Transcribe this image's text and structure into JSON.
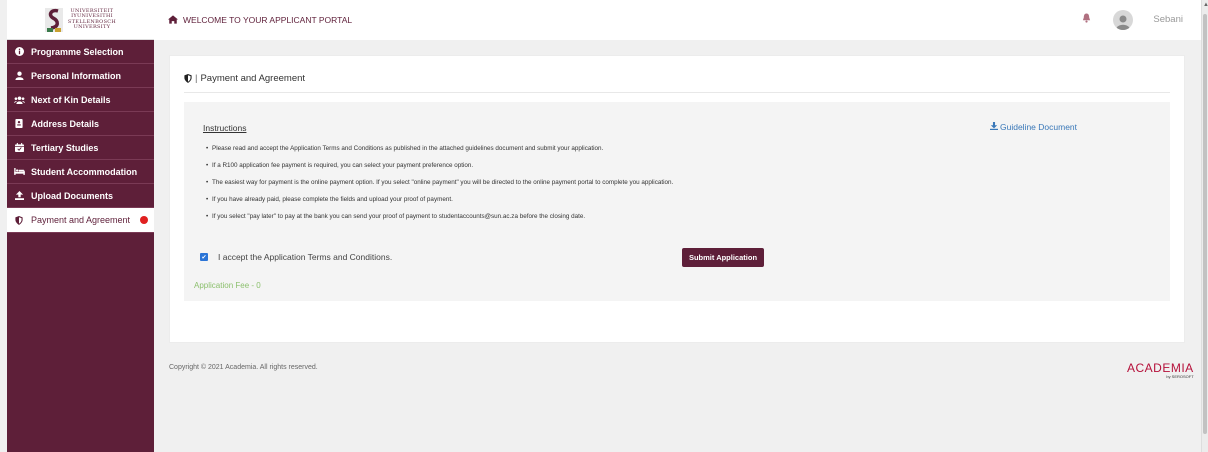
{
  "university": {
    "logo_lines": [
      "UNIVERSITEIT",
      "IYUNIVESITHI",
      "STELLENBOSCH",
      "UNIVERSITY"
    ]
  },
  "header": {
    "welcome": "WELCOME TO YOUR APPLICANT PORTAL",
    "username": "Sebani"
  },
  "sidebar": {
    "items": [
      {
        "label": "Programme Selection",
        "icon": "info-circle-icon"
      },
      {
        "label": "Personal Information",
        "icon": "user-icon"
      },
      {
        "label": "Next of Kin Details",
        "icon": "users-icon"
      },
      {
        "label": "Address Details",
        "icon": "address-card-icon"
      },
      {
        "label": "Tertiary Studies",
        "icon": "calendar-icon"
      },
      {
        "label": "Student Accommodation",
        "icon": "bed-icon"
      },
      {
        "label": "Upload Documents",
        "icon": "upload-icon"
      },
      {
        "label": "Payment and Agreement",
        "icon": "shield-icon",
        "active": true
      }
    ]
  },
  "card": {
    "title": "Payment and Agreement",
    "separator": "|"
  },
  "instructions": {
    "heading": "Instructions",
    "guideline_link": "Guideline Document",
    "bullets": [
      "Please read and accept the Application Terms and Conditions as published in the attached guidelines document and submit your application.",
      "If a R100 application fee payment is required, you can select your payment preference option.",
      "The easiest way for payment is the online payment option. If you select \"online payment\" you will be directed to the online payment portal to complete you application.",
      "If you have already paid, please complete the fields and upload your proof of payment.",
      "If you select \"pay later\" to pay at the bank you can send your proof of payment to studentaccounts@sun.ac.za before the closing date."
    ]
  },
  "agreement": {
    "checkbox_label": "I accept the Application Terms and Conditions.",
    "checked": true,
    "submit_label": "Submit Application",
    "fee_text": "Application Fee - 0"
  },
  "footer": {
    "copyright": "Copyright © 2021 Academia. All rights reserved.",
    "brand": "ACADEMIA",
    "brand_by": "by SEROSOFT"
  },
  "colors": {
    "brand": "#5e1f39",
    "link": "#3a78b8",
    "fee": "#8cc06e",
    "alert_dot": "#e02020"
  }
}
